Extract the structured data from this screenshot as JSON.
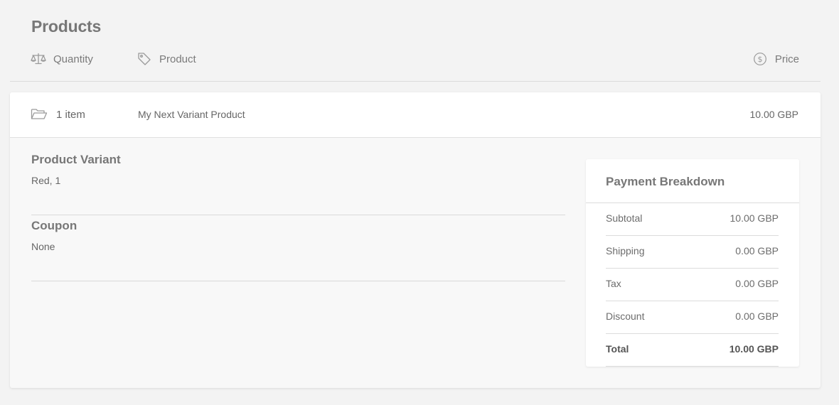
{
  "page": {
    "title": "Products"
  },
  "columns": {
    "quantity": {
      "label": "Quantity",
      "icon": "scale-icon"
    },
    "product": {
      "label": "Product",
      "icon": "tag-icon"
    },
    "price": {
      "label": "Price",
      "icon": "dollar-circle-icon"
    }
  },
  "item": {
    "icon": "folder-open-icon",
    "quantity": "1 item",
    "name": "My Next Variant Product",
    "price": "10.00 GBP"
  },
  "details": {
    "variant": {
      "label": "Product Variant",
      "value": "Red, 1"
    },
    "coupon": {
      "label": "Coupon",
      "value": "None"
    }
  },
  "breakdown": {
    "title": "Payment Breakdown",
    "rows": [
      {
        "label": "Subtotal",
        "value": "10.00 GBP"
      },
      {
        "label": "Shipping",
        "value": "0.00 GBP"
      },
      {
        "label": "Tax",
        "value": "0.00 GBP"
      },
      {
        "label": "Discount",
        "value": "0.00 GBP"
      },
      {
        "label": "Total",
        "value": "10.00 GBP"
      }
    ]
  },
  "colors": {
    "background": "#f3f3f3",
    "card": "#f8f8f8",
    "panel": "#ffffff",
    "text": "#6c6c6c",
    "divider": "#dcdcdc"
  }
}
